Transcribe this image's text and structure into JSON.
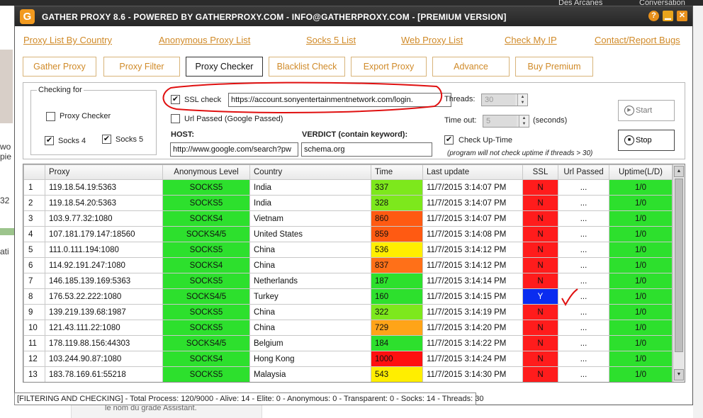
{
  "background": {
    "tabs": [
      "Des Arcanes",
      "Conversation"
    ],
    "left_fragments": [
      "wo",
      "pie",
      "32",
      "ati"
    ],
    "bottom_text": "le nom du grade Assistant."
  },
  "window": {
    "title": "GATHER PROXY 8.6 - POWERED BY GATHERPROXY.COM - INFO@GATHERPROXY.COM - [PREMIUM VERSION]",
    "logo_letter": "G",
    "help": "?",
    "minimize": "▁",
    "close": "✕"
  },
  "links": [
    "Proxy List By Country",
    "Anonymous Proxy List",
    "Socks 5 List",
    "Web Proxy List",
    "Check My IP",
    "Contact/Report Bugs"
  ],
  "tabs": [
    "Gather Proxy",
    "Proxy Filter",
    "Proxy Checker",
    "Blacklist Check",
    "Export Proxy",
    "Advance",
    "Buy Premium"
  ],
  "active_tab": "Proxy Checker",
  "checker": {
    "group_title": "Checking for",
    "proxy_checker_label": "Proxy Checker",
    "proxy_checker_checked": false,
    "socks4_label": "Socks 4",
    "socks4_checked": true,
    "socks5_label": "Socks 5",
    "socks5_checked": true,
    "ssl_label": "SSL check",
    "ssl_checked": true,
    "ssl_url": "https://account.sonyentertainmentnetwork.com/login.",
    "url_passed_label": "Url Passed (Google Passed)",
    "url_passed_checked": false,
    "host_label": "HOST:",
    "host_value": "http://www.google.com/search?pw",
    "verdict_label": "VERDICT (contain keyword):",
    "verdict_value": "schema.org",
    "threads_label": "Threads:",
    "threads_value": "30",
    "timeout_label": "Time out:",
    "timeout_value": "5",
    "seconds_label": "(seconds)",
    "uptime_label": "Check Up-Time",
    "uptime_checked": true,
    "uptime_note": "(program will not check uptime if threads > 30)",
    "start_label": "Start",
    "stop_label": "Stop",
    "check_mark": "✔"
  },
  "grid": {
    "columns": [
      "",
      "Proxy",
      "Anonymous Level",
      "Country",
      "Time",
      "Last update",
      "SSL",
      "Url Passed",
      "Uptime(L/D)"
    ],
    "rows": [
      {
        "n": "1",
        "proxy": "119.18.54.19:5363",
        "level": "SOCKS5",
        "country": "India",
        "time": "337",
        "time_color": "#7de81c",
        "updated": "11/7/2015 3:14:07 PM",
        "ssl": "N",
        "ssl_color": "#ff1c1c",
        "url": "...",
        "uptime": "1/0"
      },
      {
        "n": "2",
        "proxy": "119.18.54.20:5363",
        "level": "SOCKS5",
        "country": "India",
        "time": "328",
        "time_color": "#7de81c",
        "updated": "11/7/2015 3:14:07 PM",
        "ssl": "N",
        "ssl_color": "#ff1c1c",
        "url": "...",
        "uptime": "1/0"
      },
      {
        "n": "3",
        "proxy": "103.9.77.32:1080",
        "level": "SOCKS4",
        "country": "Vietnam",
        "time": "860",
        "time_color": "#ff5a12",
        "updated": "11/7/2015 3:14:07 PM",
        "ssl": "N",
        "ssl_color": "#ff1c1c",
        "url": "...",
        "uptime": "1/0"
      },
      {
        "n": "4",
        "proxy": "107.181.179.147:18560",
        "level": "SOCKS4/5",
        "country": "United States",
        "time": "859",
        "time_color": "#ff5a12",
        "updated": "11/7/2015 3:14:08 PM",
        "ssl": "N",
        "ssl_color": "#ff1c1c",
        "url": "...",
        "uptime": "1/0"
      },
      {
        "n": "5",
        "proxy": "111.0.111.194:1080",
        "level": "SOCKS5",
        "country": "China",
        "time": "536",
        "time_color": "#ffee00",
        "updated": "11/7/2015 3:14:12 PM",
        "ssl": "N",
        "ssl_color": "#ff1c1c",
        "url": "...",
        "uptime": "1/0"
      },
      {
        "n": "6",
        "proxy": "114.92.191.247:1080",
        "level": "SOCKS4",
        "country": "China",
        "time": "837",
        "time_color": "#ff7018",
        "updated": "11/7/2015 3:14:12 PM",
        "ssl": "N",
        "ssl_color": "#ff1c1c",
        "url": "...",
        "uptime": "1/0"
      },
      {
        "n": "7",
        "proxy": "146.185.139.169:5363",
        "level": "SOCKS5",
        "country": "Netherlands",
        "time": "187",
        "time_color": "#2de02d",
        "updated": "11/7/2015 3:14:14 PM",
        "ssl": "N",
        "ssl_color": "#ff1c1c",
        "url": "...",
        "uptime": "1/0"
      },
      {
        "n": "8",
        "proxy": "176.53.22.222:1080",
        "level": "SOCKS4/5",
        "country": "Turkey",
        "time": "160",
        "time_color": "#2de02d",
        "updated": "11/7/2015 3:14:15 PM",
        "ssl": "Y",
        "ssl_color": "#0a2cf0",
        "url": "...",
        "uptime": "1/0"
      },
      {
        "n": "9",
        "proxy": "139.219.139.68:1987",
        "level": "SOCKS5",
        "country": "China",
        "time": "322",
        "time_color": "#7de81c",
        "updated": "11/7/2015 3:14:19 PM",
        "ssl": "N",
        "ssl_color": "#ff1c1c",
        "url": "...",
        "uptime": "1/0"
      },
      {
        "n": "10",
        "proxy": "121.43.111.22:1080",
        "level": "SOCKS5",
        "country": "China",
        "time": "729",
        "time_color": "#ffa418",
        "updated": "11/7/2015 3:14:20 PM",
        "ssl": "N",
        "ssl_color": "#ff1c1c",
        "url": "...",
        "uptime": "1/0"
      },
      {
        "n": "11",
        "proxy": "178.119.88.156:44303",
        "level": "SOCKS4/5",
        "country": "Belgium",
        "time": "184",
        "time_color": "#2de02d",
        "updated": "11/7/2015 3:14:22 PM",
        "ssl": "N",
        "ssl_color": "#ff1c1c",
        "url": "...",
        "uptime": "1/0"
      },
      {
        "n": "12",
        "proxy": "103.244.90.87:1080",
        "level": "SOCKS4",
        "country": "Hong Kong",
        "time": "1000",
        "time_color": "#ff1010",
        "updated": "11/7/2015 3:14:24 PM",
        "ssl": "N",
        "ssl_color": "#ff1c1c",
        "url": "...",
        "uptime": "1/0"
      },
      {
        "n": "13",
        "proxy": "183.78.169.61:55218",
        "level": "SOCKS5",
        "country": "Malaysia",
        "time": "543",
        "time_color": "#ffee00",
        "updated": "11/7/2015 3:14:30 PM",
        "ssl": "N",
        "ssl_color": "#ff1c1c",
        "url": "...",
        "uptime": "1/0"
      }
    ]
  },
  "status_bar": "[FILTERING AND CHECKING] - Total Process: 120/9000 - Alive: 14 - Elite: 0 - Anonymous: 0 - Transparent: 0 - Socks: 14 - Threads: 30",
  "colors": {
    "link": "#d08a28",
    "level_green": "#2de02d",
    "annotation_red": "#e01010",
    "titlebar": "#2e2e2e"
  }
}
